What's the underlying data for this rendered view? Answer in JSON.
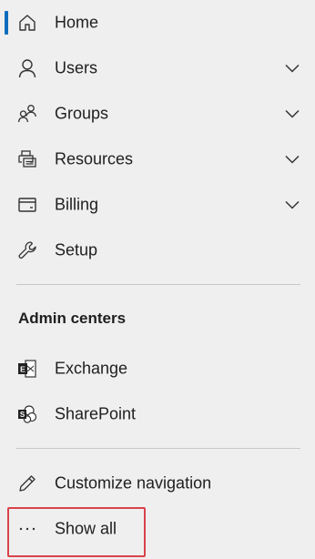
{
  "nav": {
    "items": [
      {
        "label": "Home",
        "icon": "home-icon",
        "active": true
      },
      {
        "label": "Users",
        "icon": "person-icon",
        "expandable": true
      },
      {
        "label": "Groups",
        "icon": "group-icon",
        "expandable": true
      },
      {
        "label": "Resources",
        "icon": "printer-icon",
        "expandable": true
      },
      {
        "label": "Billing",
        "icon": "credit-card-icon",
        "expandable": true
      },
      {
        "label": "Setup",
        "icon": "wrench-icon"
      }
    ],
    "admin_centers": {
      "title": "Admin centers",
      "items": [
        {
          "label": "Exchange",
          "icon": "exchange-icon"
        },
        {
          "label": "SharePoint",
          "icon": "sharepoint-icon"
        }
      ]
    },
    "footer": {
      "customize_label": "Customize navigation",
      "show_all_label": "Show all",
      "show_all_icon": "ellipsis-icon"
    }
  },
  "colors": {
    "accent": "#0f6cbd",
    "highlight": "#d9434a",
    "background": "#efefef"
  }
}
